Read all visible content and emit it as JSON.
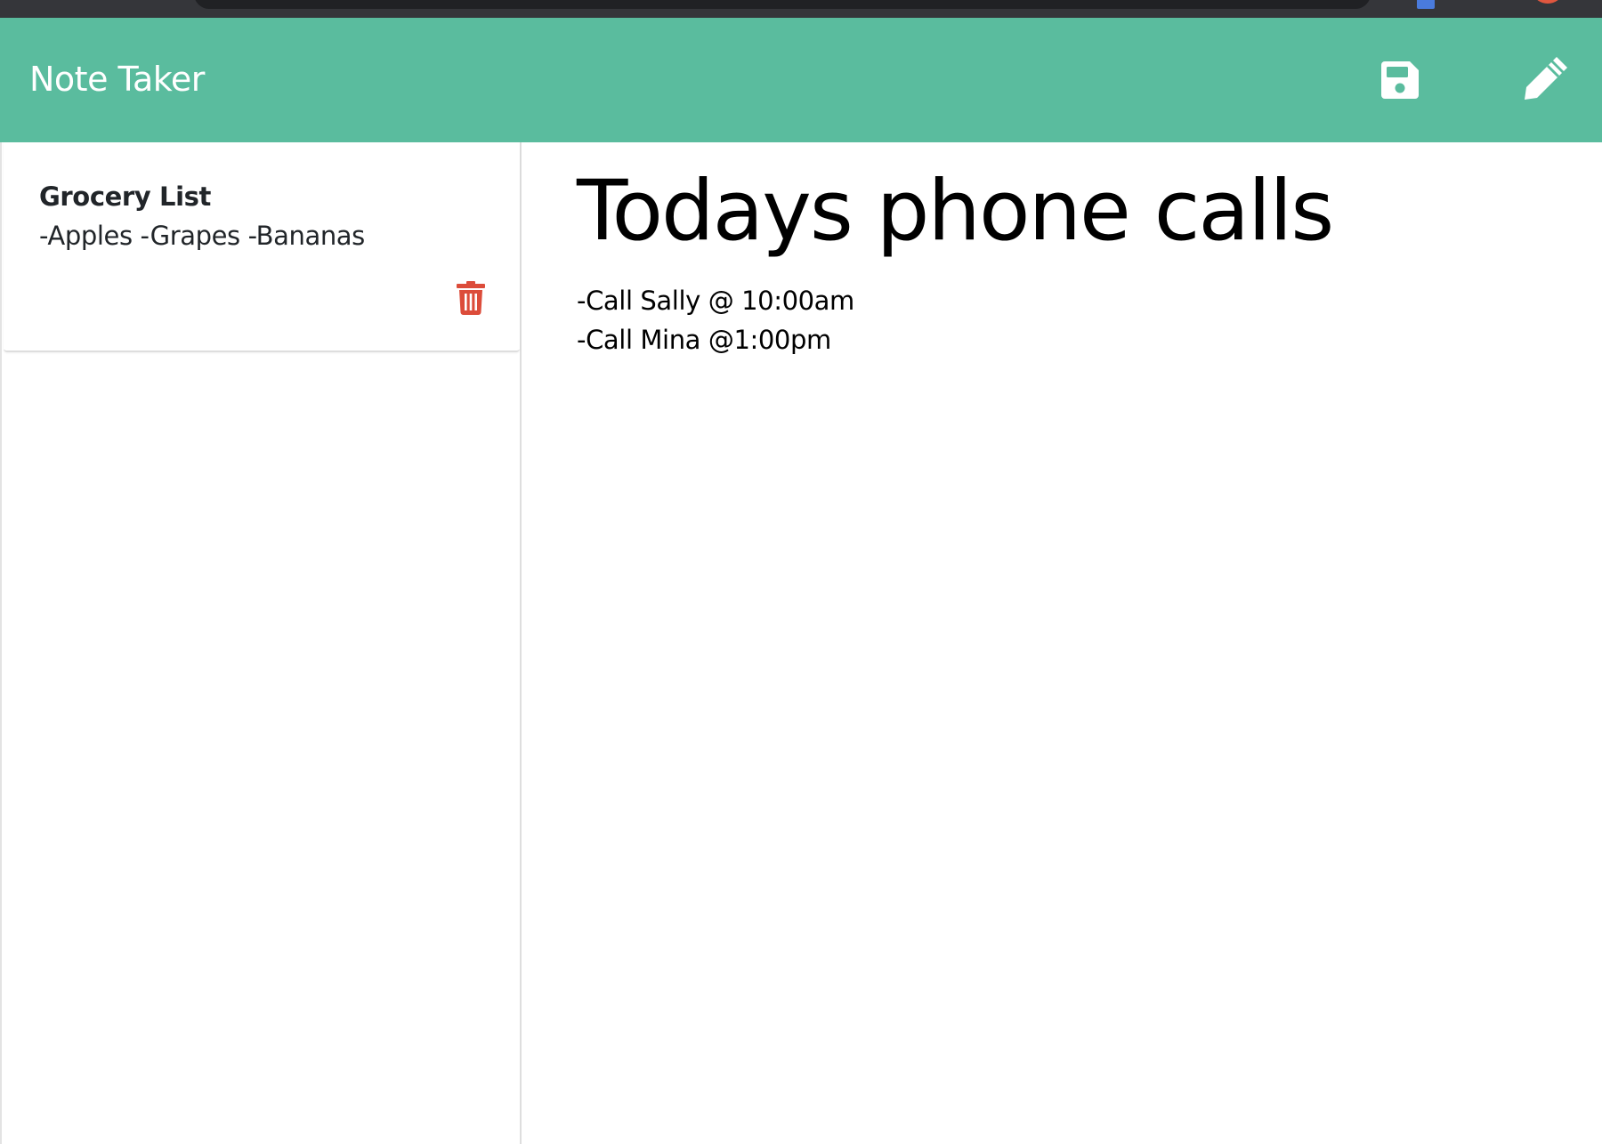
{
  "app": {
    "title": "Note Taker"
  },
  "toolbar": {
    "save_icon": "floppy-disk-save-icon",
    "new_note_icon": "pencil-icon"
  },
  "colors": {
    "navbar": "#5abc9e",
    "icon": "#ffffff",
    "delete": "#dc4c3a",
    "browser_chrome": "#35363a"
  },
  "sidebar": {
    "notes": [
      {
        "title": "Grocery List",
        "preview": "-Apples -Grapes -Bananas",
        "delete_icon": "trash-icon"
      }
    ]
  },
  "editor": {
    "title": "Todays phone calls",
    "body_lines": [
      "-Call Sally @ 10:00am",
      "-Call Mina @1:00pm"
    ]
  }
}
